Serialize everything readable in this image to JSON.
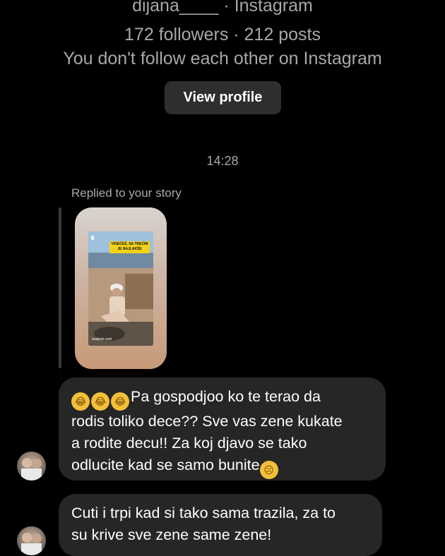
{
  "profile": {
    "username_line": "dijana____ · Instagram",
    "stats_line": "172 followers · 212 posts",
    "relationship_line": "You don't follow each other on Instagram",
    "view_profile_label": "View profile"
  },
  "thread": {
    "timestamp": "14:28",
    "reply_note": "Replied to your story",
    "story": {
      "banner_text": "VIDEĆEŠ, SA TREĆIM JE NAJLAKŠE",
      "caption": "ovakom svet"
    },
    "messages": [
      {
        "text": "Pa gospodjoo ko te terao da rodis toliko dece?? Sve vas zene kukate a rodite decu!! Za koj djavo se tako odlucite kad se samo bunite",
        "line1": "Pa gospodjoo ko te terao da",
        "line2": "rodis toliko dece?? Sve vas zene kukate",
        "line3": "a rodite decu!! Za koj djavo se tako",
        "line4": "odlucite kad se samo bunite",
        "leading_emoji": "rolling-on-floor-laughing-emoji",
        "trailing_emoji": "disappointed-face-emoji"
      },
      {
        "text": "Cuti i trpi kad si tako sama trazila, za to su krive sve zene same zene!",
        "line1": "Cuti i trpi kad si tako sama trazila, za to",
        "line2": "su krive sve zene same zene!"
      }
    ]
  },
  "colors": {
    "background": "#000000",
    "bubble": "#262626",
    "secondary_text": "#a8a8a8",
    "button": "#2e2e2e"
  }
}
